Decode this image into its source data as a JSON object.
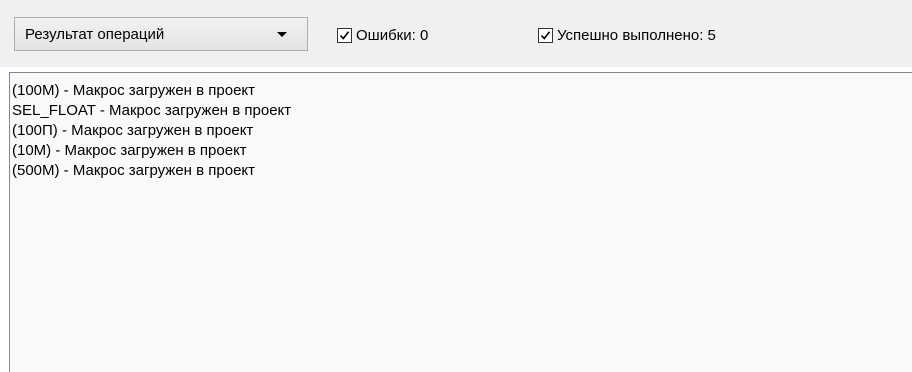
{
  "toolbar": {
    "view_select": {
      "selected": "Результат операций",
      "icon": "chevron-down-icon"
    },
    "errors_filter": {
      "label": "Ошибки: 0",
      "checked": true
    },
    "success_filter": {
      "label": "Успешно выполнено: 5",
      "checked": true
    }
  },
  "log": {
    "lines": [
      "(100М) - Макрос загружен в проект",
      "SEL_FLOAT - Макрос загружен в проект",
      "(100П) - Макрос загружен в проект",
      "(10М) - Макрос загружен в проект",
      "(500М) - Макрос загружен в проект"
    ]
  },
  "colors": {
    "toolbar_bg": "#f0f0f0",
    "log_bg": "#f9f9f9",
    "border": "#828790"
  }
}
